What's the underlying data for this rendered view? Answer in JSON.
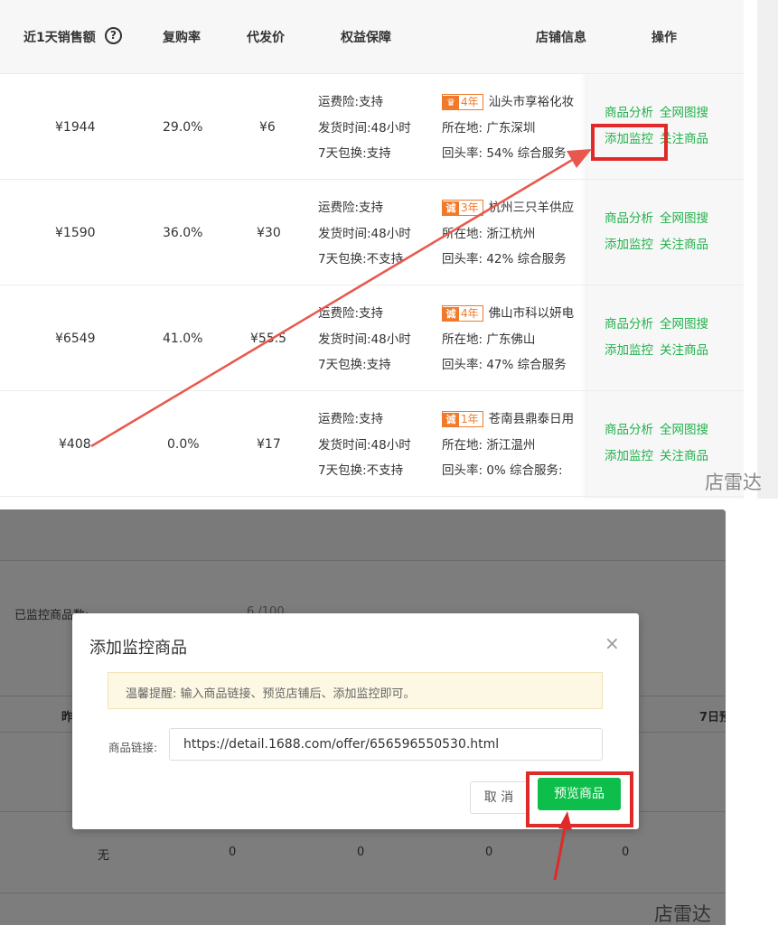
{
  "table": {
    "headers": {
      "sales_1d": "近1天销售额",
      "repurchase": "复购率",
      "dropship_price": "代发价",
      "benefits": "权益保障",
      "shop_info": "店铺信息",
      "operations": "操作"
    },
    "help_icon": "?",
    "rows": [
      {
        "sales": "¥1944",
        "repurchase": "29.0%",
        "price": "¥6",
        "benefit_1": "运费险:支持",
        "benefit_2": "发货时间:48小时",
        "benefit_3": "7天包换:支持",
        "badge_icon": "♛",
        "badge_years": "4年",
        "shop_name": "汕头市享裕化妆",
        "location": "所在地:  广东深圳",
        "return_rate": "回头率:  54%   综合服务"
      },
      {
        "sales": "¥1590",
        "repurchase": "36.0%",
        "price": "¥30",
        "benefit_1": "运费险:支持",
        "benefit_2": "发货时间:48小时",
        "benefit_3": "7天包换:不支持",
        "badge_icon": "诚",
        "badge_years": "3年",
        "shop_name": "杭州三只羊供应",
        "location": "所在地:  浙江杭州",
        "return_rate": "回头率:  42%   综合服务"
      },
      {
        "sales": "¥6549",
        "repurchase": "41.0%",
        "price": "¥55.5",
        "benefit_1": "运费险:支持",
        "benefit_2": "发货时间:48小时",
        "benefit_3": "7天包换:支持",
        "badge_icon": "诚",
        "badge_years": "4年",
        "shop_name": "佛山市科以妍电",
        "location": "所在地:  广东佛山",
        "return_rate": "回头率:  47%   综合服务"
      },
      {
        "sales": "¥408",
        "repurchase": "0.0%",
        "price": "¥17",
        "benefit_1": "运费险:支持",
        "benefit_2": "发货时间:48小时",
        "benefit_3": "7天包换:不支持",
        "badge_icon": "诚",
        "badge_years": "1年",
        "shop_name": "苍南县鼎泰日用",
        "location": "所在地:  浙江温州",
        "return_rate": "回头率:  0%   综合服务:"
      }
    ],
    "actions": {
      "analysis": "商品分析",
      "image_search": "全网图搜",
      "add_monitor": "添加监控",
      "follow": "关注商品"
    }
  },
  "watermark": "店雷达",
  "background_page": {
    "monitored_count_label": "已监控商品数:",
    "monitored_count_value": "6 /100",
    "col_yesterday": "昨",
    "col_7day": "7日预",
    "row_none": "无",
    "zero": "0"
  },
  "modal": {
    "title": "添加监控商品",
    "close_icon": "×",
    "tip_label": "温馨提醒:",
    "tip_text": "温馨提醒:  输入商品链接、预览店铺后、添加监控即可。",
    "link_label": "商品链接:",
    "link_value": "https://detail.1688.com/offer/656596550530.html",
    "cancel_label": "取 消",
    "preview_label": "预览商品"
  },
  "colors": {
    "accent_green": "#22b24c",
    "button_green": "#0dbe4a",
    "highlight_red": "#e02a2a",
    "badge_orange": "#f07a2a",
    "tip_background": "#fcf8e3"
  }
}
